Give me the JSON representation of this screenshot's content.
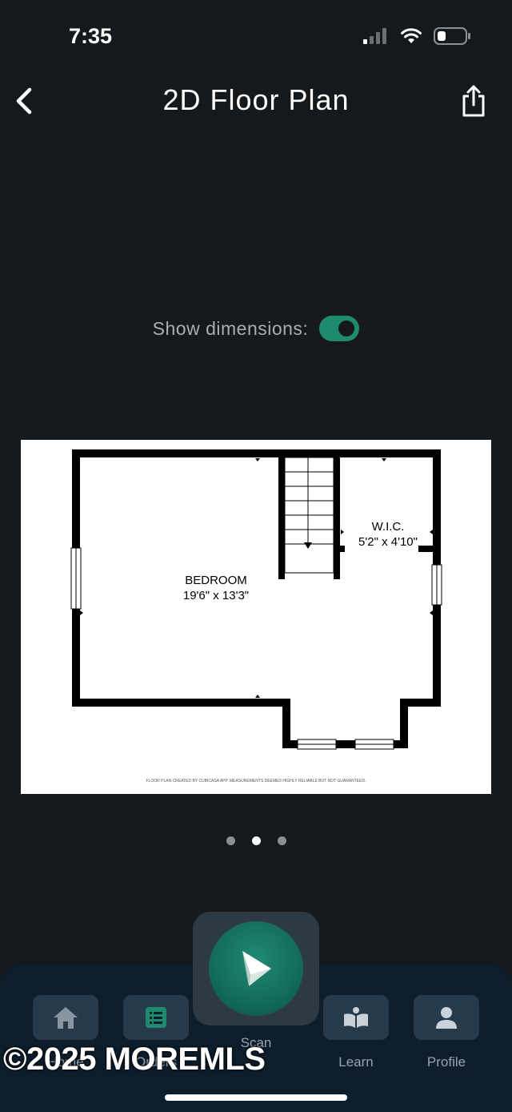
{
  "status": {
    "time": "7:35"
  },
  "header": {
    "title": "2D Floor Plan"
  },
  "dimensions": {
    "label": "Show dimensions:",
    "enabled": true
  },
  "floor_plan": {
    "rooms": [
      {
        "name": "BEDROOM",
        "dims": "19'6\" x 13'3\""
      },
      {
        "name": "W.I.C.",
        "dims": "5'2\" x 4'10\""
      }
    ],
    "disclaimer": "FLOOR PLAN CREATED BY CUBICASA APP. MEASUREMENTS DEEMED HIGHLY RELIABLE BUT NOT GUARANTEED."
  },
  "pager": {
    "count": 3,
    "active": 2
  },
  "tabs": [
    {
      "label": "Home",
      "icon": "home-icon"
    },
    {
      "label": "Orders",
      "icon": "orders-icon"
    },
    {
      "label": "Scan",
      "icon": "scan-icon"
    },
    {
      "label": "Learn",
      "icon": "book-icon"
    },
    {
      "label": "Profile",
      "icon": "person-icon"
    }
  ],
  "watermark": "©2025 MOREMLS",
  "colors": {
    "accent": "#1e8a6e",
    "background": "#16191b",
    "tabbar": "#0c1e2c"
  }
}
